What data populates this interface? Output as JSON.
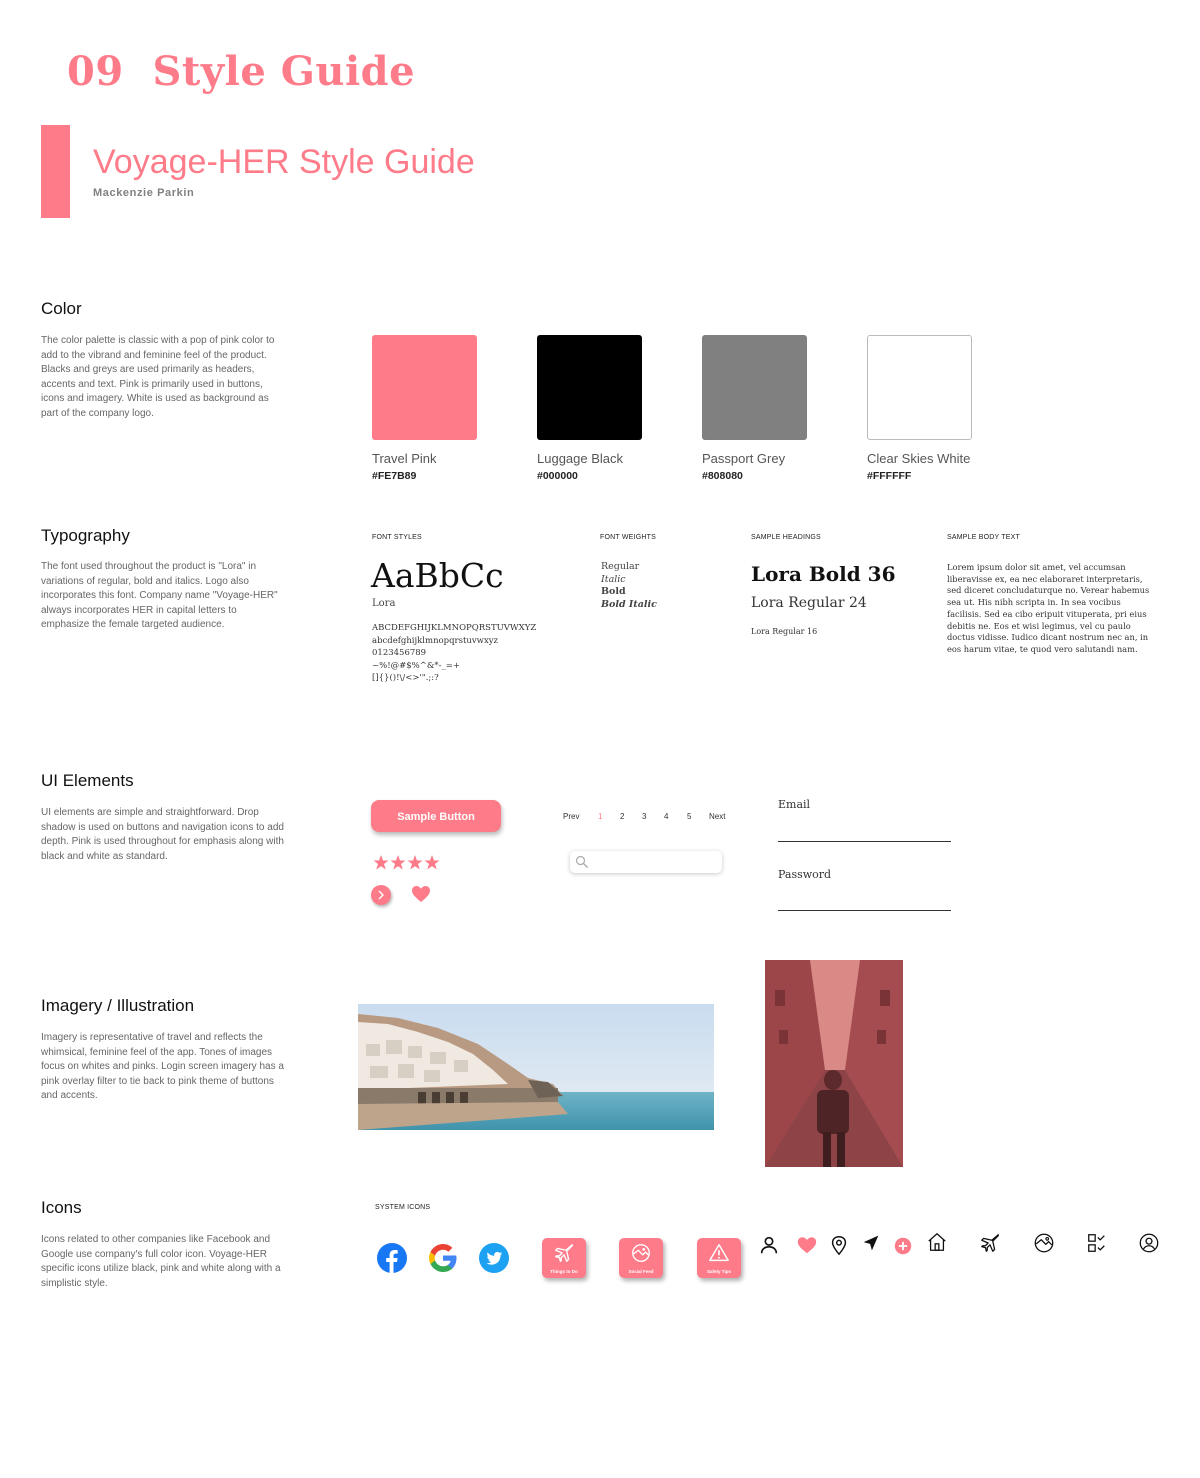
{
  "page": {
    "number": "09",
    "heading": "Style Guide",
    "doc_title": "Voyage-HER Style Guide",
    "author": "Mackenzie Parkin"
  },
  "color_section": {
    "title": "Color",
    "description": "The color palette is classic with a pop of pink color to add to the vibrand and feminine feel of the product. Blacks and greys are used primarily as headers, accents and text. Pink is primarily used in buttons, icons and imagery. White is used as background as part of the company logo.",
    "swatches": [
      {
        "name": "Travel Pink",
        "hex": "#FE7B89"
      },
      {
        "name": "Luggage Black",
        "hex": "#000000"
      },
      {
        "name": "Passport Grey",
        "hex": "#808080"
      },
      {
        "name": "Clear Skies White",
        "hex": "#FFFFFF"
      }
    ]
  },
  "typography_section": {
    "title": "Typography",
    "description": "The font used throughout the product is \"Lora\" in variations of regular, bold and italics. Logo also incorporates this font. Company name \"Voyage-HER\" always incorporates HER in capital letters to emphasize the female targeted audience.",
    "font_styles_label": "FONT STYLES",
    "specimen": "AaBbCc",
    "font_name": "Lora",
    "glyph_lines": [
      "ABCDEFGHIJKLMNOPQRSTUVWXYZ",
      "abcdefghijklmnopqrstuvwxyz",
      "0123456789",
      "~%!@#$%^&*-_=+",
      "[]{}()!\\/<>'\".;:?"
    ],
    "font_weights_label": "FONT WEIGHTS",
    "weights": [
      "Regular",
      "Italic",
      "Bold",
      "Bold Italic"
    ],
    "sample_headings_label": "SAMPLE HEADINGS",
    "headings": [
      "Lora Bold 36",
      "Lora Regular 24",
      "Lora Regular 16"
    ],
    "sample_body_label": "SAMPLE BODY TEXT",
    "body_text": "Lorem ipsum dolor sit amet, vel accumsan liberavisse ex, ea nec elaboraret interpretaris, sed diceret concludaturque no. Verear habemus sea ut. His nibh scripta in. In sea vocibus facilisis. Sed ea cibo eripuit vituperata, pri eius debitis ne. Eos et wisi legimus, vel cu paulo doctus vidisse. Iudico dicant nostrum nec an, in eos harum vitae, te quod vero salutandi nam."
  },
  "ui_section": {
    "title": "UI Elements",
    "description": "UI elements are simple and straightforward. Drop shadow is used on buttons and navigation icons to add depth. Pink is used throughout for emphasis along with black and white as standard.",
    "button_label": "Sample Button",
    "pagination": {
      "prev": "Prev",
      "pages": [
        "1",
        "2",
        "3",
        "4",
        "5"
      ],
      "active": "1",
      "next": "Next"
    },
    "rating": 4,
    "email_label": "Email",
    "password_label": "Password"
  },
  "imagery_section": {
    "title": "Imagery / Illustration",
    "description": "Imagery is representative of travel and reflects the whimsical, feminine feel of the app. Tones of images focus on whites and pinks. Login screen imagery has a pink overlay filter to tie back to pink theme of buttons and accents."
  },
  "icons_section": {
    "title": "Icons",
    "description": "Icons related to other companies like Facebook and Google use company's full color icon. Voyage-HER specific icons utilize black, pink and white along with a simplistic style.",
    "system_icons_label": "SYSTEM ICONS",
    "brand_icons": [
      "facebook-icon",
      "google-icon",
      "twitter-icon"
    ],
    "app_tiles": [
      "Things to Do",
      "Social Feed",
      "Safety Tips"
    ],
    "system_icons": [
      "user-icon",
      "heart-icon",
      "location-pin-icon",
      "navigation-arrow-icon",
      "plus-circle-icon",
      "home-icon",
      "airplane-icon",
      "explore-icon",
      "checklist-icon",
      "account-circle-icon"
    ]
  },
  "colors": {
    "accent": "#FE7B89",
    "black": "#000000",
    "grey": "#808080",
    "white": "#FFFFFF"
  }
}
